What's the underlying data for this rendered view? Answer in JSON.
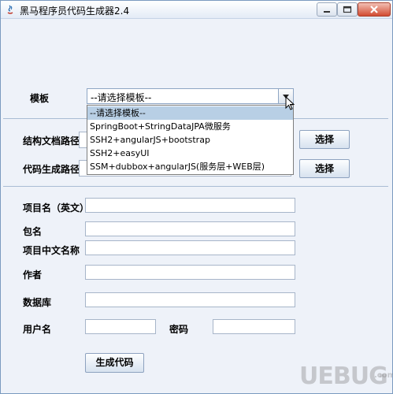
{
  "window": {
    "title": "黑马程序员代码生成器2.4"
  },
  "template": {
    "label": "模板",
    "selected": "--请选择模板--",
    "options": [
      "--请选择模板--",
      "SpringBoot+StringDataJPA微服务",
      "SSH2+angularJS+bootstrap",
      "SSH2+easyUI",
      "SSM+dubbox+angularJS(服务层+WEB层)"
    ]
  },
  "paths": {
    "struct_label": "结构文档路径",
    "output_label": "代码生成路径",
    "choose_label": "选择"
  },
  "form": {
    "project_name_en_label": "项目名（英文）",
    "package_label": "包名",
    "project_name_cn_label": "项目中文名称",
    "author_label": "作者",
    "database_label": "数据库",
    "username_label": "用户名",
    "password_label": "密码"
  },
  "actions": {
    "generate_label": "生成代码"
  },
  "watermark": {
    "text": "UEBUG",
    "suffix": ".com"
  }
}
